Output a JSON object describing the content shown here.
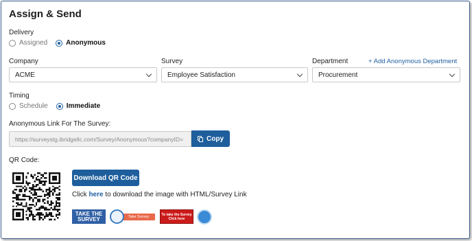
{
  "page": {
    "title": "Assign & Send"
  },
  "delivery": {
    "label": "Delivery",
    "options": [
      {
        "label": "Assigned",
        "selected": false
      },
      {
        "label": "Anonymous",
        "selected": true
      }
    ]
  },
  "company": {
    "label": "Company",
    "value": "ACME"
  },
  "survey": {
    "label": "Survey",
    "value": "Employee Satisfaction"
  },
  "department": {
    "label": "Department",
    "value": "Procurement",
    "add_link": "+ Add Anonymous Department"
  },
  "timing": {
    "label": "Timing",
    "options": [
      {
        "label": "Schedule",
        "selected": false
      },
      {
        "label": "Immediate",
        "selected": true
      }
    ]
  },
  "anon_link": {
    "label": "Anonymous Link For The Survey:",
    "value": "https://surveystg.ibridgellc.com/Survey/Anonymous?companyID=",
    "copy_label": "Copy"
  },
  "qr": {
    "label": "QR Code:",
    "download_label": "Download QR Code",
    "instruction_prefix": "Click",
    "instruction_link": "here",
    "instruction_suffix": "to download the image with HTML/Survey Link"
  },
  "badges": {
    "take_the": "TAKE THE",
    "survey": "SURVEY",
    "take_survey": "Take Survey",
    "to_take_line1": "To take the Survey",
    "to_take_line2": "Click here"
  },
  "colors": {
    "primary": "#1e5e9c",
    "link": "#1f5f9f",
    "frame": "#3b5b8c"
  }
}
